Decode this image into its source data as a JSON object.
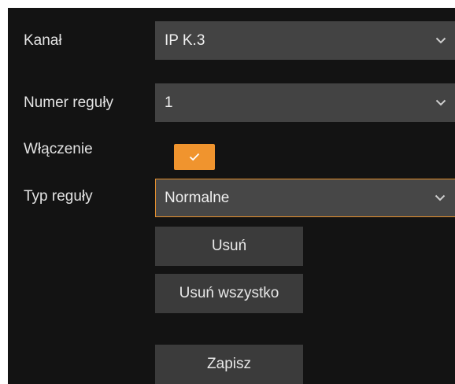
{
  "form": {
    "channel": {
      "label": "Kanał",
      "value": "IP K.3",
      "icon": "chevron-down-icon"
    },
    "rule_number": {
      "label": "Numer reguły",
      "value": "1",
      "icon": "chevron-down-icon"
    },
    "enable": {
      "label": "Włączenie",
      "checked": true,
      "icon": "checkmark-icon"
    },
    "rule_type": {
      "label": "Typ reguły",
      "value": "Normalne",
      "icon": "chevron-down-icon"
    }
  },
  "buttons": {
    "delete": "Usuń",
    "delete_all": "Usuń wszystko",
    "save": "Zapisz"
  },
  "colors": {
    "panel_background": "#131313",
    "field_background": "#434343",
    "button_background": "#3b3b3b",
    "accent": "#f0942e",
    "text": "#e3e3e3"
  }
}
